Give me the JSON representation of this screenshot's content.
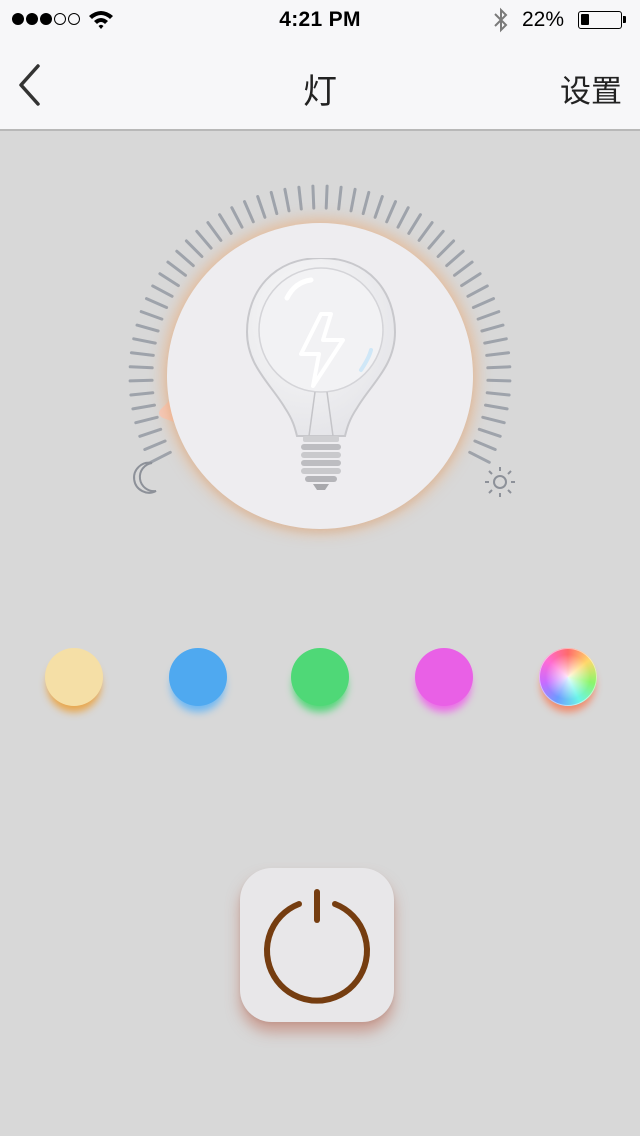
{
  "status_bar": {
    "signal_full": 3,
    "signal_empty": 2,
    "time": "4:21 PM",
    "battery_text": "22%",
    "battery_level": 0.22,
    "icons": [
      "wifi-icon",
      "bluetooth-icon",
      "battery-icon"
    ]
  },
  "nav": {
    "back_icon": "chevron-left-icon",
    "title": "灯",
    "settings_label": "设置"
  },
  "dial": {
    "icons": [
      "moon-icon",
      "sun-icon",
      "bulb-icon",
      "lightning-icon"
    ],
    "level": 0.05,
    "tick_count": 56,
    "glow_color": "#ecac78",
    "tick_color": "#9ea3ab"
  },
  "color_options": [
    {
      "name": "warm-white",
      "color": "#f5dfa6",
      "shadow": "#e9a64a"
    },
    {
      "name": "blue",
      "color": "#4fa9f0",
      "shadow": "#6fb8f3"
    },
    {
      "name": "green",
      "color": "#4fd877",
      "shadow": "#56d67b"
    },
    {
      "name": "pink",
      "color": "#e960e6",
      "shadow": "#ec6ce8"
    },
    {
      "name": "rainbow",
      "color": "conic",
      "shadow": "#f08a6a"
    }
  ],
  "power": {
    "icon": "power-icon",
    "color": "#753d10"
  }
}
